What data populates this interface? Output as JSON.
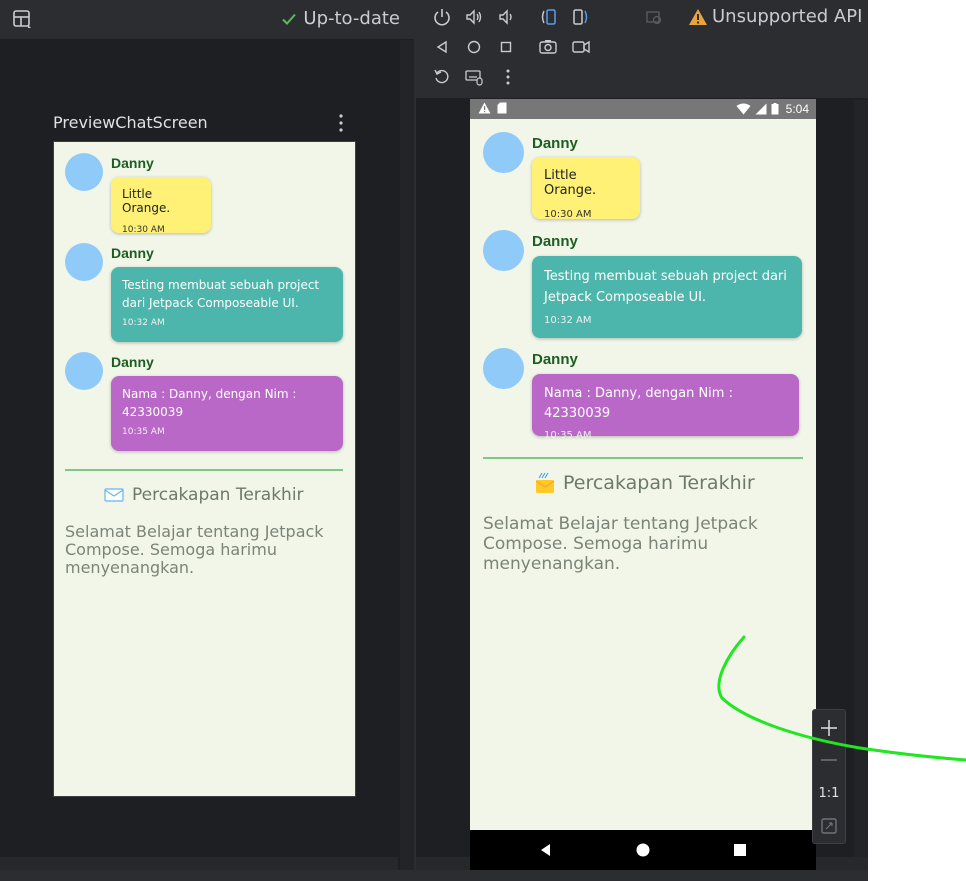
{
  "left": {
    "status": "Up-to-date",
    "preview_title": "PreviewChatScreen"
  },
  "chat": {
    "messages": [
      {
        "sender": "Danny",
        "text": "Little Orange.",
        "time": "10:30 AM",
        "color": "#fff176"
      },
      {
        "sender": "Danny",
        "text": "Testing membuat sebuah project dari Jetpack Composeable UI.",
        "time": "10:32 AM",
        "color": "#4db6ac"
      },
      {
        "sender": "Danny",
        "text": "Nama : Danny, dengan Nim : 42330039",
        "time": "10:35 AM",
        "color": "#ba68c8"
      }
    ],
    "section_title": "Percakapan Terakhir",
    "footer": "Selamat Belajar tentang Jetpack Compose. Semoga harimu menyenangkan."
  },
  "emulator": {
    "warning": "Unsupported API",
    "clock": "5:04",
    "zoom_ratio": "1:1"
  },
  "colors": {
    "avatar": "#90caf9",
    "sender": "#1b5e20",
    "divider": "#81c784",
    "background": "#f1f6e9"
  }
}
